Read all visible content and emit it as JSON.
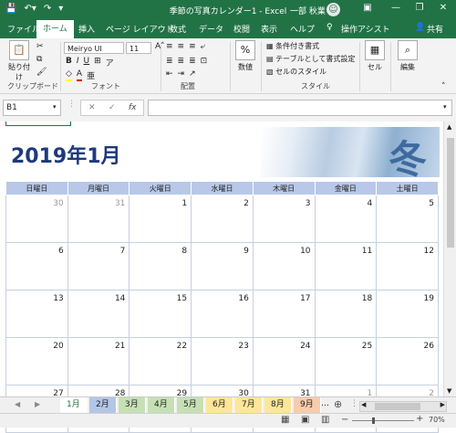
{
  "titlebar": {
    "title": "季節の写真カレンダー1  -  Excel",
    "user": "一部 秋業",
    "minimize": "—",
    "restore": "❐",
    "close": "✕"
  },
  "tabs": [
    {
      "label": "ファイル"
    },
    {
      "label": "ホーム"
    },
    {
      "label": "挿入"
    },
    {
      "label": "ページ レイアウト"
    },
    {
      "label": "数式"
    },
    {
      "label": "データ"
    },
    {
      "label": "校閲"
    },
    {
      "label": "表示"
    },
    {
      "label": "ヘルプ"
    },
    {
      "label": "操作アシスト"
    }
  ],
  "share_label": "共有",
  "ribbon": {
    "paste": "貼り付け",
    "clipboard": "クリップボード",
    "font_name": "Meiryo UI",
    "font_size": "11",
    "font": "フォント",
    "alignment": "配置",
    "percent_label": "%",
    "number": "数値",
    "cond_format": "条件付き書式",
    "table_format": "テーブルとして書式設定",
    "cell_style": "セルのスタイル",
    "styles": "スタイル",
    "cells": "セル",
    "editing": "編集"
  },
  "formula_bar": {
    "name_box": "B1",
    "fx": "fx",
    "value": ""
  },
  "calendar": {
    "title": "2019年1月",
    "image_char": "冬",
    "weekdays": [
      "日曜日",
      "月曜日",
      "火曜日",
      "水曜日",
      "木曜日",
      "金曜日",
      "土曜日"
    ],
    "weeks": [
      [
        "30",
        "31",
        "1",
        "2",
        "3",
        "4",
        "5"
      ],
      [
        "6",
        "7",
        "8",
        "9",
        "10",
        "11",
        "12"
      ],
      [
        "13",
        "14",
        "15",
        "16",
        "17",
        "18",
        "19"
      ],
      [
        "20",
        "21",
        "22",
        "23",
        "24",
        "25",
        "26"
      ],
      [
        "27",
        "28",
        "29",
        "30",
        "31",
        "1",
        "2"
      ]
    ]
  },
  "sheet_tabs": [
    "1月",
    "2月",
    "3月",
    "4月",
    "5月",
    "6月",
    "7月",
    "8月",
    "9月"
  ],
  "sheet_tab_colors": [
    "#ffffff",
    "#b4c6e7",
    "#c6e0b4",
    "#c6e0b4",
    "#c6e0b4",
    "#ffe699",
    "#ffe699",
    "#ffe699",
    "#f8cbad"
  ],
  "status": {
    "zoom": "70%"
  },
  "colors": {
    "accent": "#217346",
    "title_blue": "#1f3a7a",
    "header_band": "#b9c8e8"
  }
}
